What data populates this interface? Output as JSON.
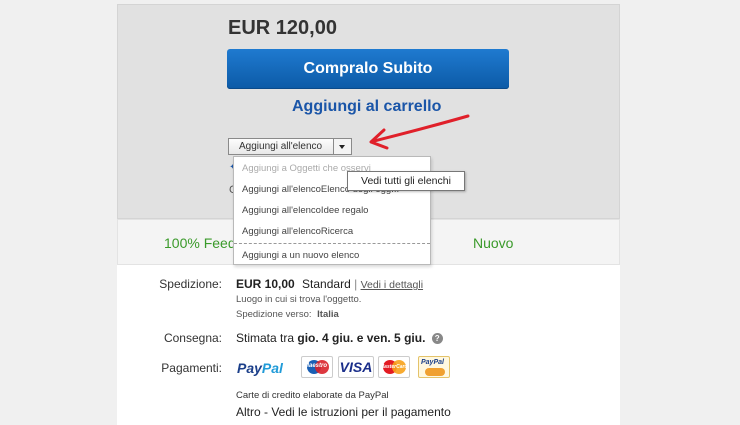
{
  "price": "EUR 120,00",
  "buy_button": "Compralo Subito",
  "cart_link": "Aggiungi al carrello",
  "list_select": "Aggiungi all'elenco",
  "menu_items": [
    "Aggiungi a Oggetti che osservi",
    "Aggiungi all'elencoElenco degli ogg...",
    "Aggiungi all'elencoIdee regalo",
    "Aggiungi all'elencoRicerca",
    "Aggiungi a un nuovo elenco"
  ],
  "tooltip": "Vedi tutti gli elenchi",
  "feedback": "100% Feed",
  "condition": "Nuovo",
  "shipping": {
    "label": "Spedizione:",
    "price": "EUR 10,00",
    "method": "Standard",
    "details_link": "Vedi i dettagli",
    "location_line": "Luogo in cui si trova l'oggetto.",
    "to_label": "Spedizione verso:",
    "to_value": "Italia"
  },
  "delivery": {
    "label": "Consegna:",
    "prefix": "Stimata tra",
    "dates": "gio. 4 giu. e ven. 5 giu."
  },
  "payments": {
    "label": "Pagamenti:",
    "paypal_a": "Pay",
    "paypal_b": "Pal",
    "maestro": "Maestro",
    "visa": "VISA",
    "mastercard": "MasterCard",
    "paypal_card": "PayPal",
    "cards_note": "Carte di credito elaborate da PayPal",
    "other": "Altro - Vedi le istruzioni per il pagamento"
  },
  "colors": {
    "buy_button": "#1565c0",
    "link": "#1a55a8",
    "positive": "#3a9a2a",
    "annotation_arrow": "#e0202a"
  }
}
